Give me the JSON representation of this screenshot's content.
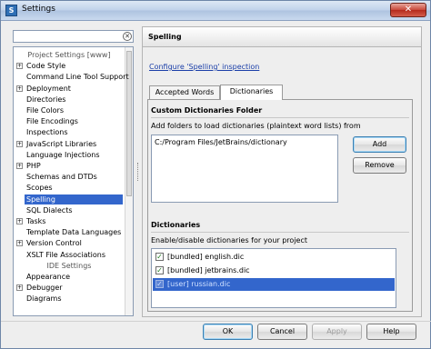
{
  "window": {
    "title": "Settings",
    "close_glyph": "✕",
    "icon": "settings-app-icon"
  },
  "search": {
    "value": "",
    "clear_glyph": "✕"
  },
  "tree": {
    "items": [
      {
        "label": "Project Settings [www]",
        "type": "section"
      },
      {
        "label": "Code Style",
        "expander": "+"
      },
      {
        "label": "Command Line Tool Support"
      },
      {
        "label": "Deployment",
        "expander": "+"
      },
      {
        "label": "Directories"
      },
      {
        "label": "File Colors"
      },
      {
        "label": "File Encodings"
      },
      {
        "label": "Inspections"
      },
      {
        "label": "JavaScript Libraries",
        "expander": "+"
      },
      {
        "label": "Language Injections"
      },
      {
        "label": "PHP",
        "expander": "+"
      },
      {
        "label": "Schemas and DTDs"
      },
      {
        "label": "Scopes"
      },
      {
        "label": "Spelling",
        "selected": true
      },
      {
        "label": "SQL Dialects"
      },
      {
        "label": "Tasks",
        "expander": "+"
      },
      {
        "label": "Template Data Languages"
      },
      {
        "label": "Version Control",
        "expander": "+"
      },
      {
        "label": "XSLT File Associations"
      },
      {
        "label": "IDE Settings",
        "type": "section"
      },
      {
        "label": "Appearance"
      },
      {
        "label": "Debugger",
        "expander": "+"
      },
      {
        "label": "Diagrams"
      }
    ]
  },
  "page": {
    "title": "Spelling",
    "inspection_link": "Configure 'Spelling' inspection",
    "tabs": [
      {
        "label": "Accepted Words",
        "active": false
      },
      {
        "label": "Dictionaries",
        "active": true
      }
    ],
    "custom_folder": {
      "title": "Custom Dictionaries Folder",
      "hint": "Add folders to load dictionaries (plaintext word lists) from",
      "paths": [
        "C:/Program Files/JetBrains/dictionary"
      ],
      "add_label": "Add",
      "remove_label": "Remove"
    },
    "dictionaries": {
      "title": "Dictionaries",
      "hint": "Enable/disable dictionaries for your project",
      "check_glyph": "✓",
      "items": [
        {
          "label": "[bundled] english.dic",
          "checked": true,
          "selected": false
        },
        {
          "label": "[bundled] jetbrains.dic",
          "checked": true,
          "selected": false
        },
        {
          "label": "[user] russian.dic",
          "checked": true,
          "selected": true
        }
      ]
    }
  },
  "footer": {
    "ok_label": "OK",
    "cancel_label": "Cancel",
    "apply_label": "Apply",
    "help_label": "Help"
  },
  "colors": {
    "selection": "#3366cc",
    "link": "#1a3ea8",
    "close_button": "#c8483a"
  }
}
